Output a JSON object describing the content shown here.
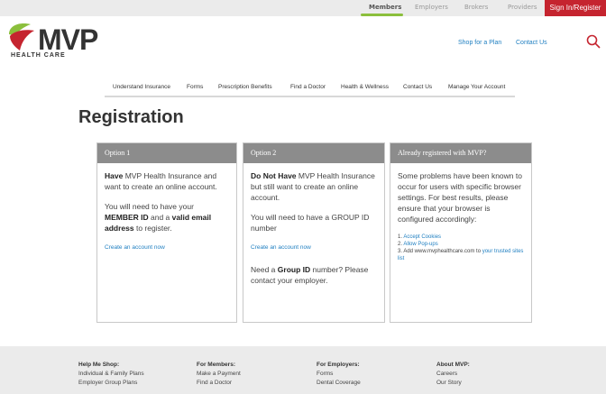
{
  "topbar": {
    "links": [
      "Members",
      "Employers",
      "Brokers",
      "Providers"
    ],
    "signin": "Sign In/Register"
  },
  "logo": {
    "name": "MVP",
    "sub": "HEALTH CARE"
  },
  "utility": {
    "shop": "Shop for a Plan",
    "contact": "Contact Us"
  },
  "nav": [
    "Understand Insurance",
    "Forms",
    "Prescription Benefits",
    "Find a Doctor",
    "Health & Wellness",
    "Contact Us",
    "Manage Your Account"
  ],
  "page_title": "Registration",
  "options": {
    "opt1": {
      "head": "Option 1",
      "p1_strong": "Have",
      "p1_rest": " MVP Health Insurance and want to create an online account.",
      "p2_a": "You will need to have your ",
      "p2_b": "MEMBER ID",
      "p2_c": " and a ",
      "p2_d": "valid email address",
      "p2_e": " to register.",
      "link": "Create an account now"
    },
    "opt2": {
      "head": "Option 2",
      "p1_strong": "Do Not Have",
      "p1_rest": " MVP Health Insurance but still want to create an online account.",
      "p2": "You will need to have a GROUP ID number",
      "link": "Create an account now",
      "p3_a": "Need a ",
      "p3_b": "Group ID",
      "p3_c": " number? Please contact your employer."
    },
    "opt3": {
      "head": "Already registered with MVP?",
      "p1": "Some problems have been known to occur for users with specific browser settings. For best results, please ensure that your browser is configured accordingly:",
      "step1_num": "1. ",
      "step1": "Accept Cookies",
      "step2_num": "2. ",
      "step2": "Allow Pop-ups",
      "step3_a": "3. Add www.mvphealthcare.com to ",
      "step3_b": "your trusted sites list"
    }
  },
  "footer": {
    "col1": {
      "head": "Help Me Shop:",
      "items": [
        "Individual & Family Plans",
        "Employer Group Plans"
      ]
    },
    "col2": {
      "head": "For Members:",
      "items": [
        "Make a Payment",
        "Find a Doctor"
      ]
    },
    "col3": {
      "head": "For Employers:",
      "items": [
        "Forms",
        "Dental Coverage"
      ]
    },
    "col4": {
      "head": "About MVP:",
      "items": [
        "Careers",
        "Our Story"
      ]
    }
  },
  "colors": {
    "brand_red": "#c5242f",
    "link_blue": "#1f7fc1",
    "card_head": "#8c8c8c",
    "accent_green": "#8bbf3c"
  }
}
